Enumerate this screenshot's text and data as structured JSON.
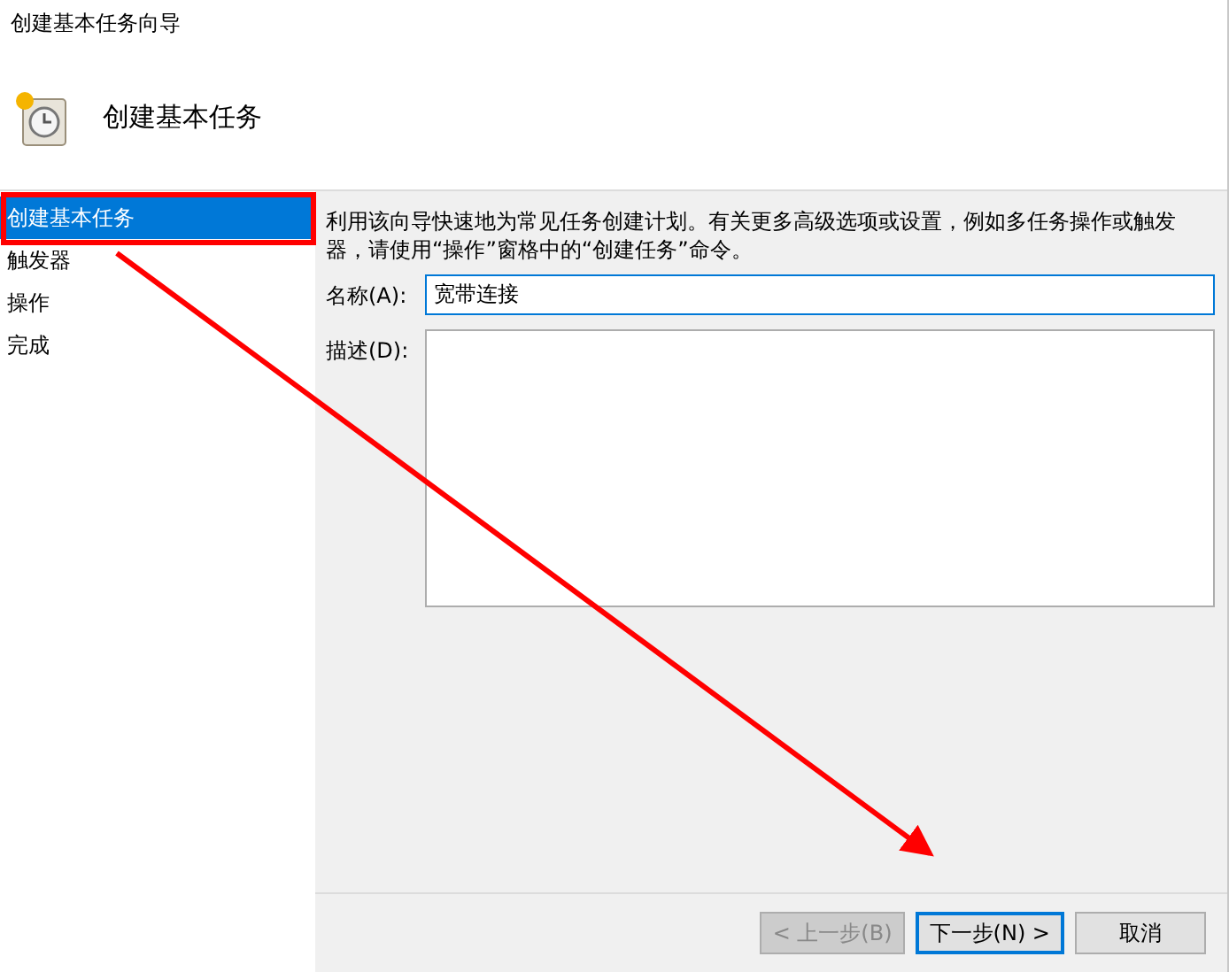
{
  "window": {
    "title": "创建基本任务向导"
  },
  "header": {
    "title": "创建基本任务"
  },
  "sidebar": {
    "items": [
      {
        "label": "创建基本任务",
        "selected": true
      },
      {
        "label": "触发器",
        "selected": false
      },
      {
        "label": "操作",
        "selected": false
      },
      {
        "label": "完成",
        "selected": false
      }
    ]
  },
  "content": {
    "intro": "利用该向导快速地为常见任务创建计划。有关更多高级选项或设置，例如多任务操作或触发器，请使用“操作”窗格中的“创建任务”命令。",
    "name_label": "名称(A):",
    "name_value": "宽带连接",
    "description_label": "描述(D):"
  },
  "buttons": [
    {
      "label": "< 上一步(B)",
      "disabled": true,
      "default": false
    },
    {
      "label": "下一步(N) >",
      "disabled": false,
      "default": true
    },
    {
      "label": "取消",
      "disabled": false,
      "default": false
    }
  ]
}
